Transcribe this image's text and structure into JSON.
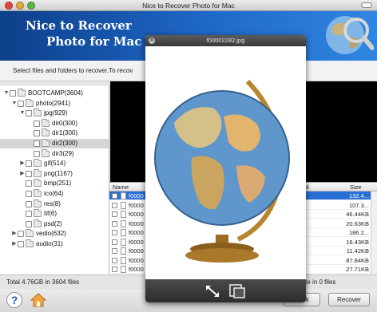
{
  "window": {
    "title": "Nice to Recover Photo for Mac"
  },
  "banner": {
    "line1": "Nice to Recover",
    "line2": "Photo for Mac"
  },
  "instruction": "Select files and folders to recover.To recov",
  "tree": [
    {
      "label": "BOOTCAMP(3604)",
      "expanded": true,
      "level": 0
    },
    {
      "label": "photo(2941)",
      "expanded": true,
      "level": 1
    },
    {
      "label": "jpg(929)",
      "expanded": true,
      "level": 2
    },
    {
      "label": "dir0(300)",
      "level": 3
    },
    {
      "label": "dir1(300)",
      "level": 3
    },
    {
      "label": "dir2(300)",
      "level": 3,
      "selected": true
    },
    {
      "label": "dir3(29)",
      "level": 3
    },
    {
      "label": "gif(514)",
      "expanded": false,
      "level": 2
    },
    {
      "label": "png(1167)",
      "expanded": false,
      "level": 2
    },
    {
      "label": "bmp(251)",
      "level": 2
    },
    {
      "label": "ico(64)",
      "level": 2
    },
    {
      "label": "res(8)",
      "level": 2
    },
    {
      "label": "tif(6)",
      "level": 2
    },
    {
      "label": "psd(2)",
      "level": 2
    },
    {
      "label": "vedio(632)",
      "expanded": false,
      "level": 1
    },
    {
      "label": "audio(31)",
      "expanded": false,
      "level": 1
    }
  ],
  "list": {
    "headers": {
      "name": "Name",
      "modified": "ed",
      "size": "Size"
    },
    "rows": [
      {
        "name": "f0000",
        "size": "132.4...",
        "selected": true
      },
      {
        "name": "f0000",
        "size": "107.3..."
      },
      {
        "name": "f0000",
        "size": "46.44KB"
      },
      {
        "name": "f0000",
        "size": "20.63KB"
      },
      {
        "name": "f0000",
        "size": "186.2..."
      },
      {
        "name": "f0000",
        "size": "16.43KB"
      },
      {
        "name": "f0000",
        "size": "11.42KB"
      },
      {
        "name": "f0000",
        "size": "87.84KB"
      },
      {
        "name": "f0000",
        "size": "27.71KB"
      }
    ]
  },
  "status": {
    "left": "Total 4.76GB in 3604 files",
    "right": "Selected 0Byte in 0 files"
  },
  "buttons": {
    "back": "Back",
    "recover": "Recover"
  },
  "quicklook": {
    "filename": "f00002282.jpg"
  },
  "colors": {
    "banner": "#1f68c8",
    "selection": "#2a6fd6"
  }
}
